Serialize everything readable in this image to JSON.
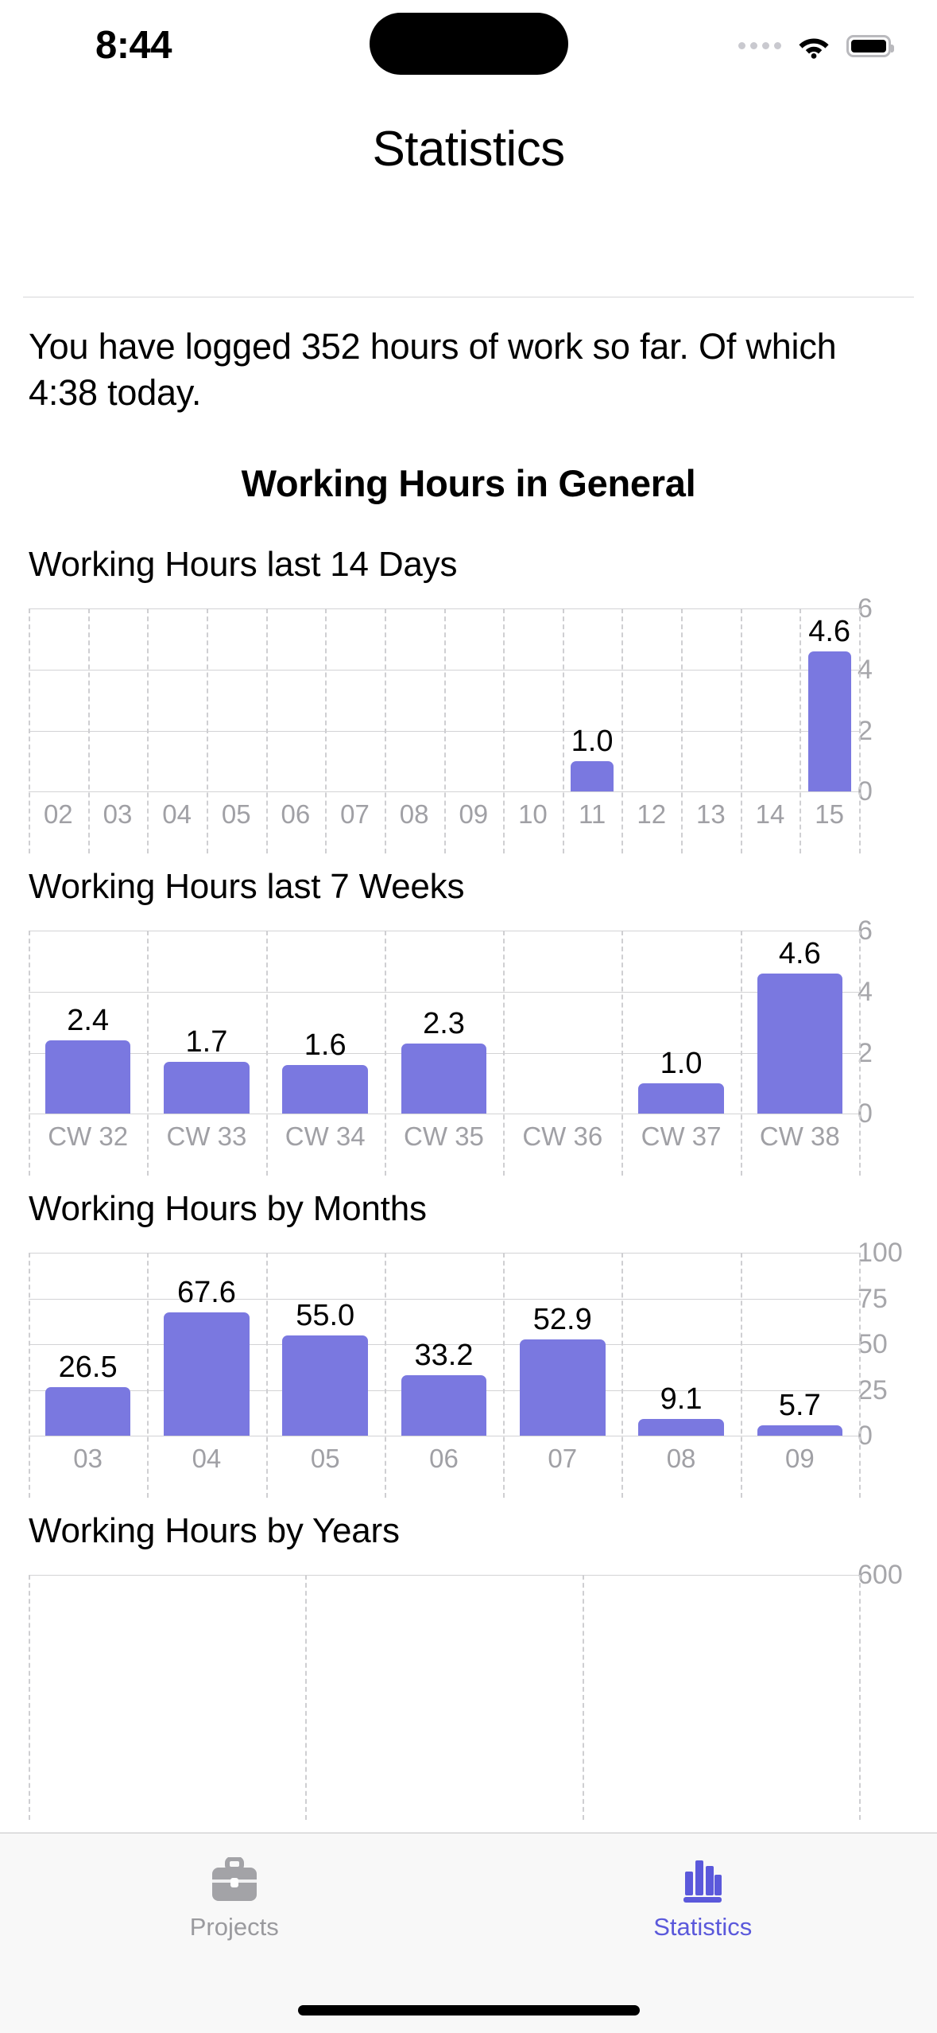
{
  "status_bar": {
    "time": "8:44",
    "icons": [
      "signal-dots-icon",
      "wifi-icon",
      "battery-icon"
    ]
  },
  "nav": {
    "title": "Statistics"
  },
  "intro_text": "You have logged 352 hours of work so far. Of which 4:38 today.",
  "section_title": "Working Hours in General",
  "colors": {
    "bar": "#7a78e0",
    "accent": "#5b59db",
    "grid": "#d3d3d5",
    "tick_text": "#a6a6aa",
    "inactive_tab": "#9a9a9e"
  },
  "charts": [
    {
      "title": "Working Hours last 14 Days",
      "chart_data": {
        "type": "bar",
        "title": "Working Hours last 14 Days",
        "xlabel": "",
        "ylabel": "",
        "categories": [
          "02",
          "03",
          "04",
          "05",
          "06",
          "07",
          "08",
          "09",
          "10",
          "11",
          "12",
          "13",
          "14",
          "15"
        ],
        "values": [
          0,
          0,
          0,
          0,
          0,
          0,
          0,
          0,
          0,
          1.0,
          0,
          0,
          0,
          4.6
        ],
        "labels": [
          "",
          "",
          "",
          "",
          "",
          "",
          "",
          "",
          "",
          "1.0",
          "",
          "",
          "",
          "4.6"
        ],
        "yticks": [
          0,
          2,
          4,
          6
        ],
        "ylim": [
          0,
          6
        ],
        "grid": true,
        "legend": "none"
      }
    },
    {
      "title": "Working Hours last 7 Weeks",
      "chart_data": {
        "type": "bar",
        "title": "Working Hours last 7 Weeks",
        "xlabel": "",
        "ylabel": "",
        "categories": [
          "CW 32",
          "CW 33",
          "CW 34",
          "CW 35",
          "CW 36",
          "CW 37",
          "CW 38"
        ],
        "values": [
          2.4,
          1.7,
          1.6,
          2.3,
          0,
          1.0,
          4.6
        ],
        "labels": [
          "2.4",
          "1.7",
          "1.6",
          "2.3",
          "",
          "1.0",
          "4.6"
        ],
        "yticks": [
          0,
          2,
          4,
          6
        ],
        "ylim": [
          0,
          6
        ],
        "grid": true,
        "legend": "none"
      }
    },
    {
      "title": "Working Hours by Months",
      "chart_data": {
        "type": "bar",
        "title": "Working Hours by Months",
        "xlabel": "",
        "ylabel": "",
        "categories": [
          "03",
          "04",
          "05",
          "06",
          "07",
          "08",
          "09"
        ],
        "values": [
          26.5,
          67.6,
          55.0,
          33.2,
          52.9,
          9.1,
          5.7
        ],
        "labels": [
          "26.5",
          "67.6",
          "55.0",
          "33.2",
          "52.9",
          "9.1",
          "5.7"
        ],
        "yticks": [
          0,
          25,
          50,
          75,
          100
        ],
        "ylim": [
          0,
          100
        ],
        "grid": true,
        "legend": "none"
      }
    },
    {
      "title": "Working Hours by Years",
      "chart_data": {
        "type": "bar",
        "title": "Working Hours by Years",
        "xlabel": "",
        "ylabel": "",
        "categories": [
          "",
          "",
          ""
        ],
        "values": [],
        "labels": [],
        "yticks": [
          600
        ],
        "ylim": [
          0,
          600
        ],
        "grid": true,
        "legend": "none",
        "note": "chart clipped by tab bar; only top gridline at 600 visible"
      }
    }
  ],
  "tab_bar": {
    "tabs": [
      {
        "label": "Projects",
        "icon": "briefcase-icon",
        "active": false
      },
      {
        "label": "Statistics",
        "icon": "bar-chart-icon",
        "active": true
      }
    ]
  }
}
